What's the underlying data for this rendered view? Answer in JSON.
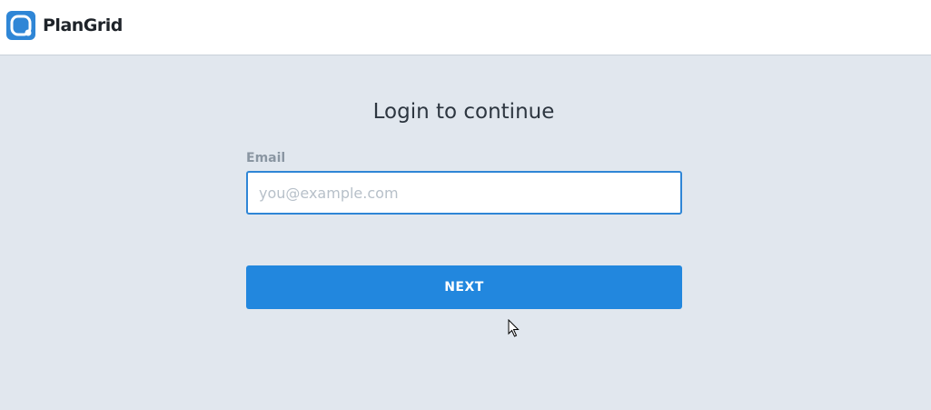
{
  "header": {
    "brand_name": "PlanGrid",
    "logo_icon": "plangrid-logo-icon",
    "brand_color": "#2f86d6"
  },
  "login": {
    "title": "Login to continue",
    "email_label": "Email",
    "email_placeholder": "you@example.com",
    "email_value": "",
    "next_label": "NEXT",
    "accent_color": "#2287de"
  },
  "pointer": {
    "icon": "mouse-cursor-icon"
  }
}
